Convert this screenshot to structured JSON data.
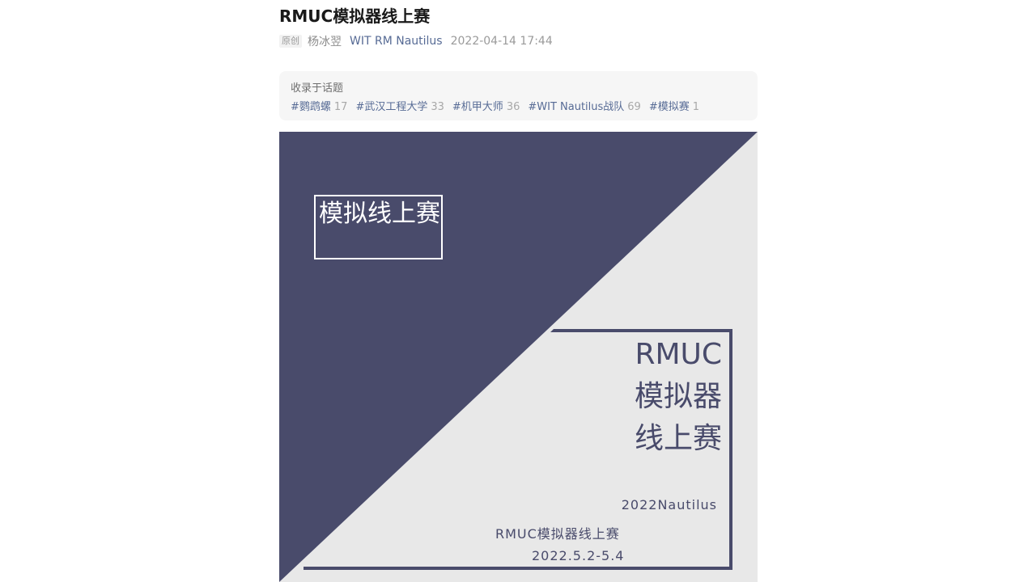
{
  "article": {
    "title": "RMUC模拟器线上赛",
    "original_badge": "原创",
    "author": "杨冰翌",
    "account": "WIT RM Nautilus",
    "date": "2022-04-14 17:44"
  },
  "topics": {
    "label": "收录于话题",
    "items": [
      {
        "name": "#鹦鹉螺",
        "count": "17"
      },
      {
        "name": "#武汉工程大学",
        "count": "33"
      },
      {
        "name": "#机甲大师",
        "count": "36"
      },
      {
        "name": "#WIT Nautilus战队",
        "count": "69"
      },
      {
        "name": "#模拟赛",
        "count": "1"
      }
    ]
  },
  "poster": {
    "main_title": "模拟线上赛",
    "line1": "RMUC",
    "line2": "模拟器",
    "line3": "线上赛",
    "sub1": "2022Nautilus",
    "sub2": "RMUC模拟器线上赛",
    "sub3": "2022.5.2-5.4",
    "colors": {
      "dark": "#494b6b",
      "light": "#e8e8e8",
      "frame_text": "#ffffff"
    }
  }
}
